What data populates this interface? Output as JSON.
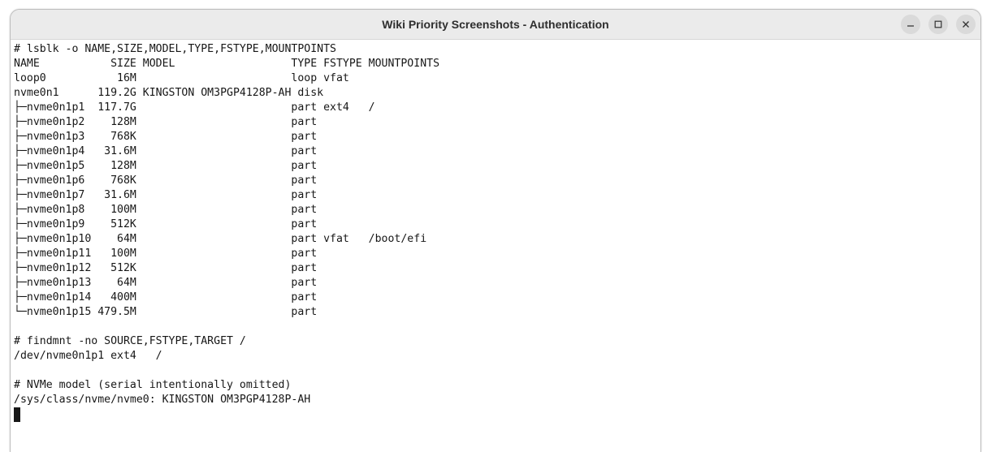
{
  "window": {
    "title": "Wiki Priority Screenshots - Authentication"
  },
  "controls": {
    "minimize": "minimize-icon",
    "maximize": "maximize-icon",
    "close": "close-icon"
  },
  "terminal": {
    "lines": [
      "# lsblk -o NAME,SIZE,MODEL,TYPE,FSTYPE,MOUNTPOINTS",
      "NAME           SIZE MODEL                  TYPE FSTYPE MOUNTPOINTS",
      "loop0           16M                        loop vfat",
      "nvme0n1      119.2G KINGSTON OM3PGP4128P-AH disk",
      "├─nvme0n1p1  117.7G                        part ext4   /",
      "├─nvme0n1p2    128M                        part",
      "├─nvme0n1p3    768K                        part",
      "├─nvme0n1p4   31.6M                        part",
      "├─nvme0n1p5    128M                        part",
      "├─nvme0n1p6    768K                        part",
      "├─nvme0n1p7   31.6M                        part",
      "├─nvme0n1p8    100M                        part",
      "├─nvme0n1p9    512K                        part",
      "├─nvme0n1p10    64M                        part vfat   /boot/efi",
      "├─nvme0n1p11   100M                        part",
      "├─nvme0n1p12   512K                        part",
      "├─nvme0n1p13    64M                        part",
      "├─nvme0n1p14   400M                        part",
      "└─nvme0n1p15 479.5M                        part",
      "",
      "# findmnt -no SOURCE,FSTYPE,TARGET /",
      "/dev/nvme0n1p1 ext4   /",
      "",
      "# NVMe model (serial intentionally omitted)",
      "/sys/class/nvme/nvme0: KINGSTON OM3PGP4128P-AH"
    ]
  }
}
